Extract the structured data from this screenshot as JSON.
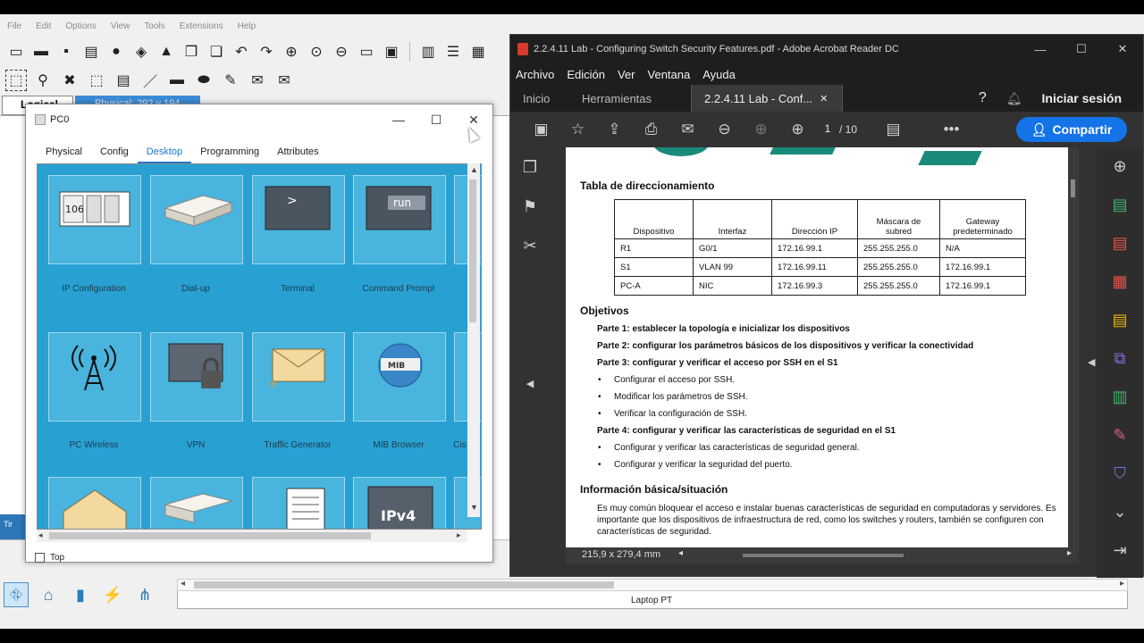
{
  "pt": {
    "menu": [
      "File",
      "Edit",
      "Options",
      "View",
      "Tools",
      "Extensions",
      "Help"
    ],
    "tab_logical": "Logical",
    "tab_physical": "Physical: 292 y 194",
    "side_label": "Tir",
    "device_label": "Laptop PT"
  },
  "pc0": {
    "title": "PC0",
    "tabs": [
      "Physical",
      "Config",
      "Desktop",
      "Programming",
      "Attributes"
    ],
    "active_tab": "Desktop",
    "apps": [
      {
        "label": "IP Configuration",
        "icon": "ip-config-icon",
        "glyph": "106"
      },
      {
        "label": "Dial-up",
        "icon": "dialup-icon"
      },
      {
        "label": "Terminal",
        "icon": "terminal-icon",
        "glyph": ">"
      },
      {
        "label": "Command Prompt",
        "icon": "command-prompt-icon",
        "glyph": "run"
      },
      {
        "label": "PC Wireless",
        "icon": "wireless-icon"
      },
      {
        "label": "VPN",
        "icon": "vpn-icon"
      },
      {
        "label": "Traffic Generator",
        "icon": "traffic-generator-icon"
      },
      {
        "label": "MIB Browser",
        "icon": "mib-browser-icon",
        "glyph": "MIB"
      },
      {
        "label": "Cis",
        "icon": "partial-app-icon"
      }
    ],
    "row3_glyph": "IPv4",
    "top_checkbox": "Top"
  },
  "acrobat": {
    "title": "2.2.4.11 Lab - Configuring Switch Security Features.pdf - Adobe Acrobat Reader DC",
    "menu": [
      "Archivo",
      "Edición",
      "Ver",
      "Ventana",
      "Ayuda"
    ],
    "tab_home": "Inicio",
    "tab_tools": "Herramientas",
    "tab_doc": "2.2.4.11 Lab - Conf...",
    "sign_in": "Iniciar sesión",
    "page_current": "1",
    "page_total": "/ 10",
    "share": "Compartir",
    "page_size": "215,9 x 279,4 mm",
    "accent": "#1473e6"
  },
  "doc": {
    "table_title": "Tabla de direccionamiento",
    "headers": [
      "Dispositivo",
      "Interfaz",
      "Dirección IP",
      "Máscara de subred",
      "Gateway predeterminado"
    ],
    "rows": [
      [
        "R1",
        "G0/1",
        "172.16.99.1",
        "255.255.255.0",
        "N/A"
      ],
      [
        "S1",
        "VLAN 99",
        "172.16.99.11",
        "255.255.255.0",
        "172.16.99.1"
      ],
      [
        "PC-A",
        "NIC",
        "172.16.99.3",
        "255.255.255.0",
        "172.16.99.1"
      ]
    ],
    "objectives_title": "Objetivos",
    "part1": "Parte 1: establecer la topología e inicializar los dispositivos",
    "part2": "Parte 2: configurar los parámetros básicos de los dispositivos y verificar la conectividad",
    "part3": "Parte 3: configurar y verificar el acceso por SSH en el S1",
    "p3b1": "Configurar el acceso por SSH.",
    "p3b2": "Modificar los parámetros de SSH.",
    "p3b3": "Verificar la configuración de SSH.",
    "part4": "Parte 4: configurar y verificar las características de seguridad en el S1",
    "p4b1": "Configurar y verificar las características de seguridad general.",
    "p4b2": "Configurar y verificar la seguridad del puerto.",
    "background_title": "Información básica/situación",
    "background_text": "Es muy común bloquear el acceso e instalar buenas características de seguridad en computadoras y servidores. Es importante que los dispositivos de infraestructura de red, como los switches y routers, también se configuren con características de seguridad."
  }
}
